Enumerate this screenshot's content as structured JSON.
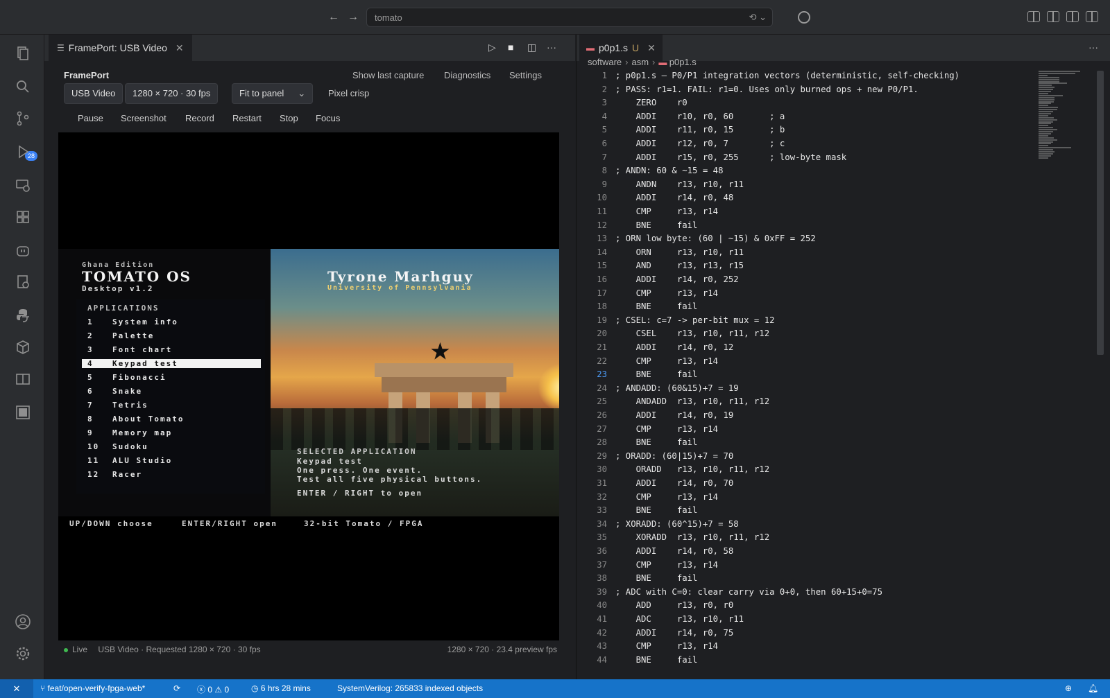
{
  "titlebar": {
    "command_center": "tomato",
    "back_arrow": "←",
    "forward_arrow": "→"
  },
  "activity_bar": {
    "icons": [
      "explorer-icon",
      "search-icon",
      "source-control-icon",
      "run-debug-icon",
      "remote-explorer-icon",
      "extensions-icon",
      "robot-icon",
      "testing-icon",
      "python-icon",
      "package-icon",
      "book-icon",
      "terminal-panel-icon",
      "account-icon",
      "settings-gear-icon"
    ],
    "source_control_badge": "28"
  },
  "left_editor": {
    "tab": {
      "label": "FramePort: USB Video",
      "close": "✕"
    },
    "tab_actions": [
      "▷",
      "■",
      "◫",
      "···"
    ],
    "header": {
      "title": "FramePort",
      "links": [
        "Show last capture",
        "Diagnostics",
        "Settings"
      ]
    },
    "toolbar": {
      "device": "USB Video",
      "resolution": "1280 × 720 · 30 fps",
      "fit": "Fit to panel",
      "fit_chevron": "⌄",
      "pixel": "Pixel crisp"
    },
    "controls": [
      "Pause",
      "Screenshot",
      "Record",
      "Restart",
      "Stop",
      "Focus"
    ],
    "status_left_live": "Live",
    "status_left_detail": "USB Video · Requested 1280 × 720 · 30 fps",
    "status_right": "1280 × 720 · 23.4 preview fps"
  },
  "os_screen": {
    "edition": "Ghana Edition",
    "os_name": "TOMATO OS",
    "version": "Desktop v1.2",
    "user_name": "Tyrone Marhguy",
    "university": "University of Pennsylvania",
    "apps_header": "APPLICATIONS",
    "apps": [
      {
        "num": "1",
        "name": "System info"
      },
      {
        "num": "2",
        "name": "Palette"
      },
      {
        "num": "3",
        "name": "Font chart"
      },
      {
        "num": "4",
        "name": "Keypad test"
      },
      {
        "num": "5",
        "name": "Fibonacci"
      },
      {
        "num": "6",
        "name": "Snake"
      },
      {
        "num": "7",
        "name": "Tetris"
      },
      {
        "num": "8",
        "name": "About Tomato"
      },
      {
        "num": "9",
        "name": "Memory map"
      },
      {
        "num": "10",
        "name": "Sudoku"
      },
      {
        "num": "11",
        "name": "ALU Studio"
      },
      {
        "num": "12",
        "name": "Racer"
      }
    ],
    "selected_index": 3,
    "selected_header": "SELECTED APPLICATION",
    "selected_name": "Keypad test",
    "selected_desc1": "One press. One event.",
    "selected_desc2": "Test all five physical buttons.",
    "selected_hint": "ENTER / RIGHT to open",
    "footer_1": "UP/DOWN choose",
    "footer_2": "ENTER/RIGHT open",
    "footer_3": "32-bit Tomato / FPGA",
    "star": "★"
  },
  "right_editor": {
    "tab": {
      "label": "p0p1.s",
      "modified": "U",
      "close": "✕",
      "icon": "asm"
    },
    "more": "···",
    "breadcrumb": [
      "software",
      "asm",
      "p0p1.s"
    ],
    "active_line": 23,
    "lines": [
      {
        "n": "1",
        "t": "; p0p1.s — P0/P1 integration vectors (deterministic, self-checking)"
      },
      {
        "n": "2",
        "t": "; PASS: r1=1. FAIL: r1=0. Uses only burned ops + new P0/P1."
      },
      {
        "n": "3",
        "t": "    ZERO    r0"
      },
      {
        "n": "4",
        "t": "    ADDI    r10, r0, 60       ; a"
      },
      {
        "n": "5",
        "t": "    ADDI    r11, r0, 15       ; b"
      },
      {
        "n": "6",
        "t": "    ADDI    r12, r0, 7        ; c"
      },
      {
        "n": "7",
        "t": "    ADDI    r15, r0, 255      ; low-byte mask"
      },
      {
        "n": "8",
        "t": "; ANDN: 60 & ~15 = 48"
      },
      {
        "n": "9",
        "t": "    ANDN    r13, r10, r11"
      },
      {
        "n": "10",
        "t": "    ADDI    r14, r0, 48"
      },
      {
        "n": "11",
        "t": "    CMP     r13, r14"
      },
      {
        "n": "12",
        "t": "    BNE     fail"
      },
      {
        "n": "13",
        "t": "; ORN low byte: (60 | ~15) & 0xFF = 252"
      },
      {
        "n": "14",
        "t": "    ORN     r13, r10, r11"
      },
      {
        "n": "15",
        "t": "    AND     r13, r13, r15"
      },
      {
        "n": "16",
        "t": "    ADDI    r14, r0, 252"
      },
      {
        "n": "17",
        "t": "    CMP     r13, r14"
      },
      {
        "n": "18",
        "t": "    BNE     fail"
      },
      {
        "n": "19",
        "t": "; CSEL: c=7 -> per-bit mux = 12"
      },
      {
        "n": "20",
        "t": "    CSEL    r13, r10, r11, r12"
      },
      {
        "n": "21",
        "t": "    ADDI    r14, r0, 12"
      },
      {
        "n": "22",
        "t": "    CMP     r13, r14"
      },
      {
        "n": "23",
        "t": "    BNE     fail"
      },
      {
        "n": "24",
        "t": "; ANDADD: (60&15)+7 = 19"
      },
      {
        "n": "25",
        "t": "    ANDADD  r13, r10, r11, r12"
      },
      {
        "n": "26",
        "t": "    ADDI    r14, r0, 19"
      },
      {
        "n": "27",
        "t": "    CMP     r13, r14"
      },
      {
        "n": "28",
        "t": "    BNE     fail"
      },
      {
        "n": "29",
        "t": "; ORADD: (60|15)+7 = 70"
      },
      {
        "n": "30",
        "t": "    ORADD   r13, r10, r11, r12"
      },
      {
        "n": "31",
        "t": "    ADDI    r14, r0, 70"
      },
      {
        "n": "32",
        "t": "    CMP     r13, r14"
      },
      {
        "n": "33",
        "t": "    BNE     fail"
      },
      {
        "n": "34",
        "t": "; XORADD: (60^15)+7 = 58"
      },
      {
        "n": "35",
        "t": "    XORADD  r13, r10, r11, r12"
      },
      {
        "n": "36",
        "t": "    ADDI    r14, r0, 58"
      },
      {
        "n": "37",
        "t": "    CMP     r13, r14"
      },
      {
        "n": "38",
        "t": "    BNE     fail"
      },
      {
        "n": "39",
        "t": "; ADC with C=0: clear carry via 0+0, then 60+15+0=75"
      },
      {
        "n": "40",
        "t": "    ADD     r13, r0, r0"
      },
      {
        "n": "41",
        "t": "    ADC     r13, r10, r11"
      },
      {
        "n": "42",
        "t": "    ADDI    r14, r0, 75"
      },
      {
        "n": "43",
        "t": "    CMP     r13, r14"
      },
      {
        "n": "44",
        "t": "    BNE     fail"
      }
    ]
  },
  "statusbar": {
    "remote": "✕",
    "branch": "feat/open-verify-fpga-web*",
    "sync": "⟳",
    "errors": "0",
    "warnings": "0",
    "time": "6 hrs 28 mins",
    "indexer": "SystemVerilog: 265833 indexed objects"
  }
}
